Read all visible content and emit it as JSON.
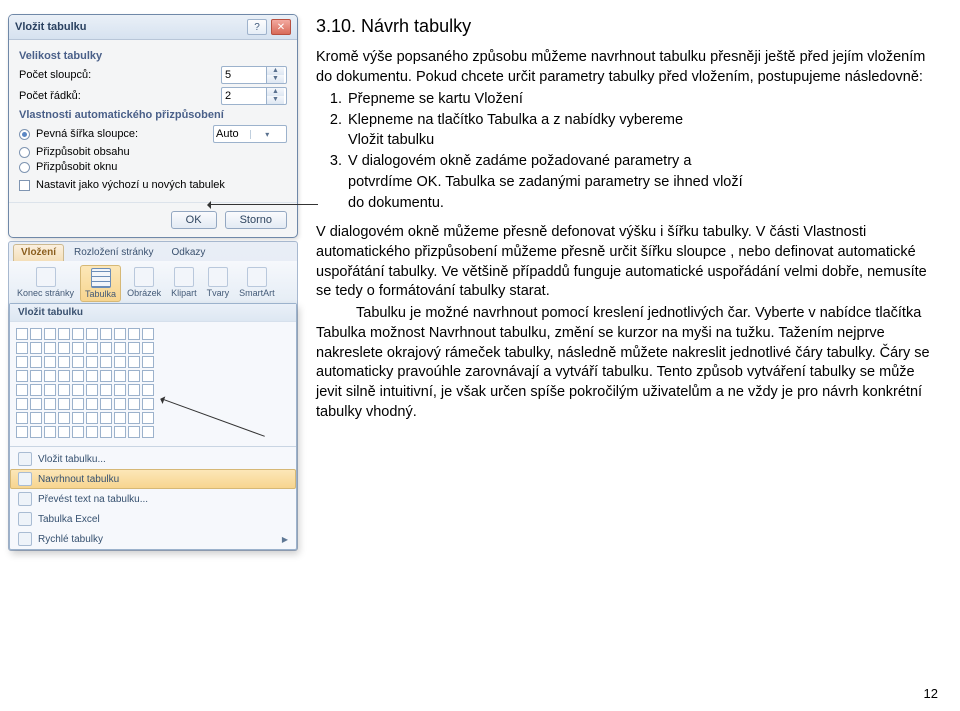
{
  "heading": "3.10. Návrh tabulky",
  "para1": "Kromě výše popsaného způsobu můžeme navrhnout tabulku přesněji ještě před jejím vložením do dokumentu. Pokud chcete určit parametry tabulky před vložením, postupujeme následovně:",
  "steps": {
    "n1": "1.",
    "s1": "Přepneme se kartu Vložení",
    "n2": "2.",
    "s2a": "Klepneme na tlačítko Tabulka a z nabídky vybereme",
    "s2b": "Vložit tabulku",
    "n3": "3.",
    "s3a": "V dialogovém okně zadáme požadované parametry a",
    "s3b": "potvrdíme OK. Tabulka se zadanými parametry se ihned vloží",
    "s3c": "do dokumentu."
  },
  "para2": "V dialogovém okně můžeme přesně defonovat výšku i šířku tabulky. V části Vlastnosti automatického přizpůsobení můžeme přesně určit šířku sloupce , nebo definovat automatické uspořátání tabulky. Ve většině případdů funguje automatické uspořádání velmi dobře, nemusíte se tedy o formátování tabulky starat.",
  "para3a": "Tabulku je možné navrhnout  pomocí kreslení jednotlivých čar. Vyberte v nabídce tlačítka Tabulka možnost Navrhnout tabulku, změní se kurzor na myši na tužku. Tažením nejprve nakreslete okrajový rámeček tabulky, následně můžete nakreslit jednotlivé čáry tabulky. Čáry se automaticky pravoúhle zarovnávají a vytváří tabulku. Tento způsob vytváření tabulky se může jevit silně intuitivní, je však určen spíše pokročilým uživatelům a ne vždy je pro návrh konkrétní tabulky vhodný.",
  "page_number": "12",
  "dialog": {
    "title": "Vložit tabulku",
    "group_size": "Velikost tabulky",
    "lbl_cols": "Počet sloupců:",
    "val_cols": "5",
    "lbl_rows": "Počet řádků:",
    "val_rows": "2",
    "group_auto": "Vlastnosti automatického přizpůsobení",
    "opt_fixed": "Pevná šířka sloupce:",
    "opt_fixed_value": "Auto",
    "opt_content": "Přizpůsobit obsahu",
    "opt_window": "Přizpůsobit oknu",
    "chk_default": "Nastavit jako výchozí u nových tabulek",
    "btn_ok": "OK",
    "btn_cancel": "Storno"
  },
  "ribbon": {
    "tabs": [
      "Vložení",
      "Rozložení stránky",
      "Odkazy"
    ],
    "items": {
      "konec": "Konec stránky",
      "tabulka": "Tabulka",
      "obrazek": "Obrázek",
      "klipart": "Klipart",
      "tvary": "Tvary",
      "smartart": "SmartArt"
    }
  },
  "dropdown": {
    "title": "Vložit tabulku",
    "items": {
      "vlozit": "Vložit tabulku...",
      "navrhnout": "Navrhnout tabulku",
      "prevest": "Převést text na tabulku...",
      "excel": "Tabulka Excel",
      "rychle": "Rychlé tabulky"
    }
  }
}
